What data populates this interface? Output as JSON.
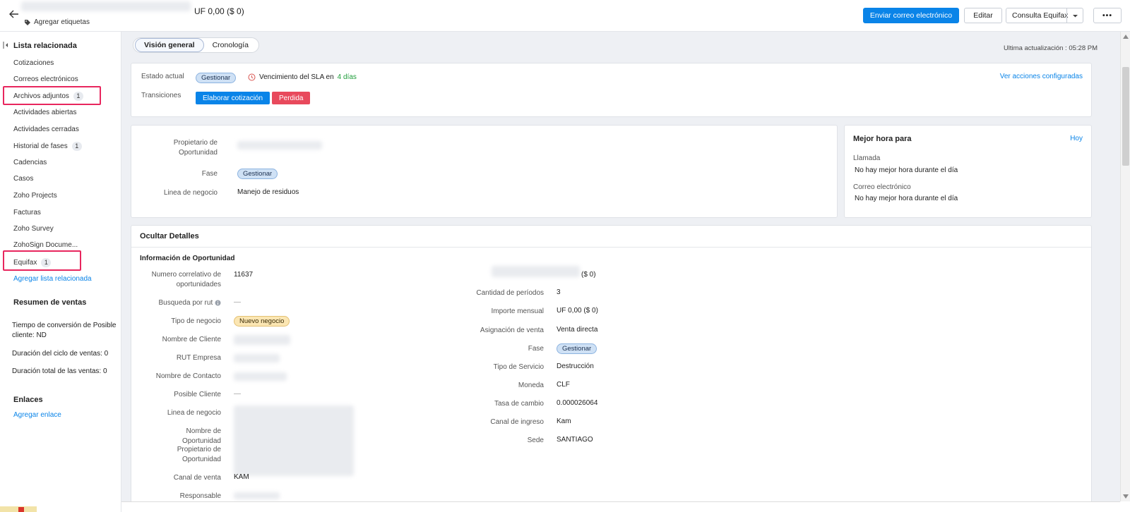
{
  "header": {
    "amount": "UF 0,00 ($ 0)",
    "add_tags": "Agregar etiquetas",
    "send_email": "Enviar correo electrónico",
    "edit": "Editar",
    "equifax_query": "Consulta Equifax",
    "more": "•••"
  },
  "sidebar": {
    "related_list_title": "Lista relacionada",
    "items": [
      {
        "label": "Cotizaciones",
        "count": ""
      },
      {
        "label": "Correos electrónicos",
        "count": ""
      },
      {
        "label": "Archivos adjuntos",
        "count": "1"
      },
      {
        "label": "Actividades abiertas",
        "count": ""
      },
      {
        "label": "Actividades cerradas",
        "count": ""
      },
      {
        "label": "Historial de fases",
        "count": "1"
      },
      {
        "label": "Cadencias",
        "count": ""
      },
      {
        "label": "Casos",
        "count": ""
      },
      {
        "label": "Zoho Projects",
        "count": ""
      },
      {
        "label": "Facturas",
        "count": ""
      },
      {
        "label": "Zoho Survey",
        "count": ""
      },
      {
        "label": "ZohoSign Docume...",
        "count": ""
      },
      {
        "label": "Equifax",
        "count": "1"
      }
    ],
    "add_related_list": "Agregar lista relacionada",
    "sales_summary_title": "Resumen de ventas",
    "conversion_time": "Tiempo de conversión de Posible cliente: ND",
    "cycle_duration": "Duración del ciclo de ventas: 0",
    "total_duration": "Duración total de las ventas: 0",
    "links_title": "Enlaces",
    "add_link": "Agregar enlace"
  },
  "main": {
    "tabs": [
      "Visión general",
      "Cronología"
    ],
    "last_update": "Ultima actualización : 05:28 PM",
    "status": {
      "current_label": "Estado actual",
      "current_value": "Gestionar",
      "sla_prefix": "Vencimiento del SLA en",
      "sla_days": "4 días",
      "transitions_label": "Transiciones",
      "transition_1": "Elaborar cotización",
      "transition_2": "Perdida",
      "view_actions": "Ver acciones configuradas"
    },
    "summary": {
      "owner_label": "Propietario de Oportunidad",
      "phase_label": "Fase",
      "phase_value": "Gestionar",
      "business_line_label": "Linea de negocio",
      "business_line_value": "Manejo de residuos"
    },
    "best_time": {
      "title": "Mejor hora para",
      "today": "Hoy",
      "call_label": "Llamada",
      "call_value": "No hay mejor hora durante el día",
      "email_label": "Correo electrónico",
      "email_value": "No hay mejor hora durante el día"
    },
    "details": {
      "hide_details": "Ocultar Detalles",
      "section_title": "Información de Oportunidad",
      "left": {
        "num_label": "Numero correlativo de oportunidades",
        "num_value": "11637",
        "rut_search_label": "Busqueda por rut",
        "rut_search_value": "—",
        "business_type_label": "Tipo de negocio",
        "business_type_value": "Nuevo negocio",
        "client_name_label": "Nombre de Cliente",
        "rut_company_label": "RUT Empresa",
        "contact_name_label": "Nombre de Contacto",
        "lead_label": "Posible Cliente",
        "lead_value": "—",
        "business_line_label": "Linea de negocio",
        "opp_name_label": "Nombre de Oportunidad",
        "owner_label": "Propietario de Oportunidad",
        "sales_channel_label": "Canal de venta",
        "sales_channel_value": "KAM",
        "responsible_label": "Responsable"
      },
      "right": {
        "amount_value": "($ 0)",
        "periods_label": "Cantidad de períodos",
        "periods_value": "3",
        "monthly_label": "Importe mensual",
        "monthly_value": "UF 0,00 ($ 0)",
        "sale_assign_label": "Asignación de venta",
        "sale_assign_value": "Venta directa",
        "phase_label": "Fase",
        "phase_value": "Gestionar",
        "service_type_label": "Tipo de Servicio",
        "service_type_value": "Destrucción",
        "currency_label": "Moneda",
        "currency_value": "CLF",
        "exchange_label": "Tasa de cambio",
        "exchange_value": "0.000026064",
        "income_channel_label": "Canal de ingreso",
        "income_channel_value": "Kam",
        "site_label": "Sede",
        "site_value": "SANTIAGO"
      }
    }
  }
}
